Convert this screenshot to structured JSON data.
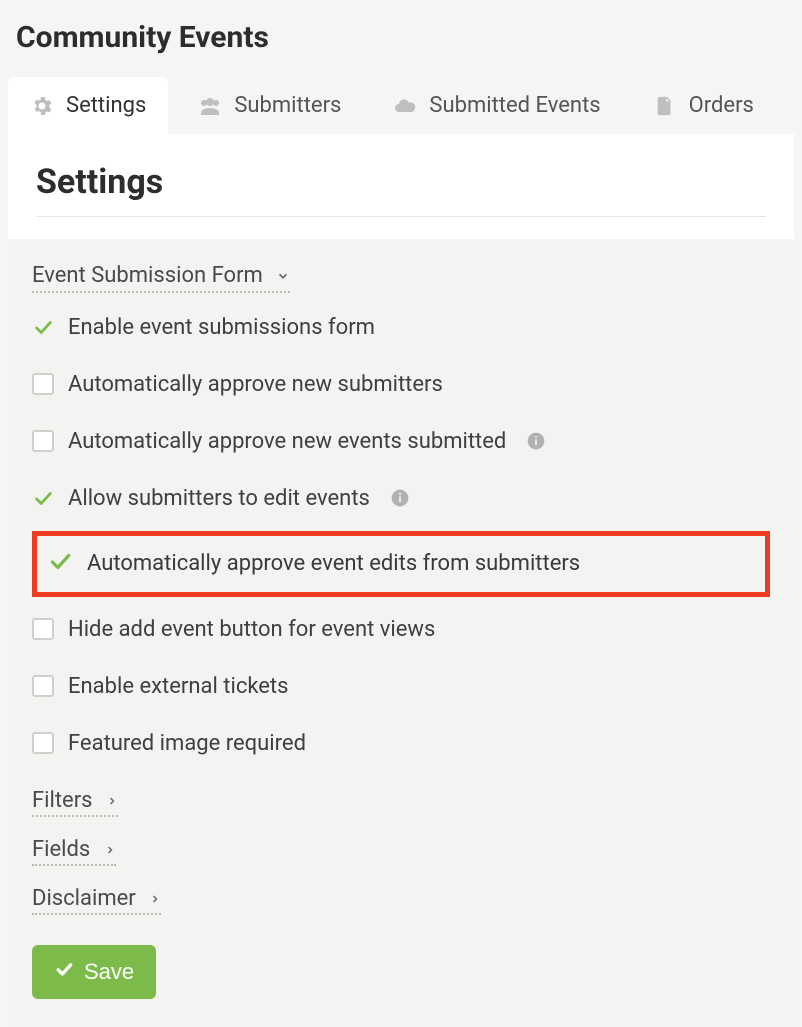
{
  "page_title": "Community Events",
  "tabs": {
    "settings": "Settings",
    "submitters": "Submitters",
    "submitted_events": "Submitted Events",
    "orders": "Orders"
  },
  "section_heading": "Settings",
  "accordion": {
    "event_submission_form": "Event Submission Form",
    "filters": "Filters",
    "fields": "Fields",
    "disclaimer": "Disclaimer"
  },
  "options": {
    "enable_form": {
      "label": "Enable event submissions form",
      "checked": true
    },
    "auto_approve_submitters": {
      "label": "Automatically approve new submitters",
      "checked": false
    },
    "auto_approve_events": {
      "label": "Automatically approve new events submitted",
      "checked": false,
      "info": true
    },
    "allow_edit": {
      "label": "Allow submitters to edit events",
      "checked": true,
      "info": true
    },
    "auto_approve_edits": {
      "label": "Automatically approve event edits from submitters",
      "checked": true,
      "highlighted": true
    },
    "hide_add_button": {
      "label": "Hide add event button for event views",
      "checked": false
    },
    "external_tickets": {
      "label": "Enable external tickets",
      "checked": false
    },
    "featured_image_required": {
      "label": "Featured image required",
      "checked": false
    }
  },
  "save_button": "Save",
  "colors": {
    "accent_green": "#7cbb4a",
    "highlight_red": "#ee3b1d"
  }
}
